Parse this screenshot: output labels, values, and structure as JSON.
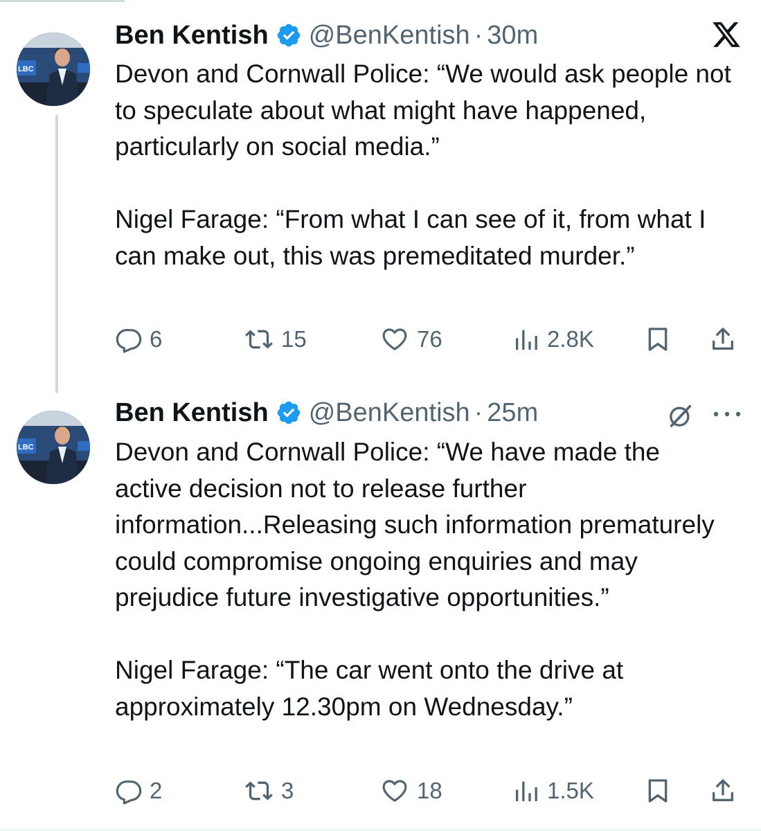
{
  "tweets": [
    {
      "author": {
        "name": "Ben Kentish",
        "handle": "@BenKentish",
        "time": "30m",
        "avatar_text": "LBC"
      },
      "paragraphs": [
        "Devon and Cornwall Police: “We would ask people not to speculate about what might have happened, particularly on social media.”",
        "Nigel Farage: “From what I can see of it, from what I can make out, this was premeditated murder.”"
      ],
      "stats": {
        "replies": "6",
        "reposts": "15",
        "likes": "76",
        "views": "2.8K"
      }
    },
    {
      "author": {
        "name": "Ben Kentish",
        "handle": "@BenKentish",
        "time": "25m",
        "avatar_text": "LBC"
      },
      "paragraphs": [
        "Devon and Cornwall Police: “We have made the active decision not to release further information...Releasing such information prematurely could compromise ongoing enquiries and may prejudice future investigative opportunities.”",
        "Nigel Farage: “The car went onto the drive at approximately 12.30pm on Wednesday.”"
      ],
      "stats": {
        "replies": "2",
        "reposts": "3",
        "likes": "18",
        "views": "1.5K"
      }
    }
  ],
  "ui": {
    "separator": "·"
  },
  "icons": {
    "verified": "verified-badge-icon",
    "brand": "x-logo-icon",
    "grok": "grok-icon",
    "more": "more-options-icon",
    "reply": "reply-icon",
    "repost": "repost-icon",
    "like": "like-icon",
    "views": "views-icon",
    "bookmark": "bookmark-icon",
    "share": "share-icon"
  },
  "colors": {
    "text": "#0f1419",
    "secondary": "#536471",
    "verified": "#1d9bf0",
    "thread_line": "#cfd9de"
  }
}
